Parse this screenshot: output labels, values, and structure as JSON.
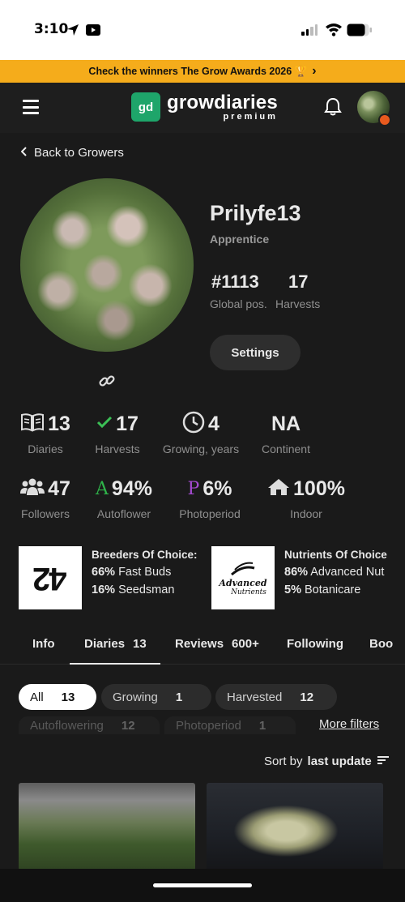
{
  "status_bar": {
    "time": "3:10"
  },
  "banner": {
    "text": "Check the winners The Grow Awards 2026 🏆",
    "arrow": "›"
  },
  "header": {
    "logo_mark": "gd",
    "logo_name": "growdiaries",
    "logo_sub": "premium"
  },
  "back_link": "Back to Growers",
  "profile": {
    "username": "Prilyfe13",
    "rank": "Apprentice",
    "global_pos": "#1113",
    "global_pos_label": "Global pos.",
    "harvests": "17",
    "harvests_label": "Harvests",
    "settings_label": "Settings"
  },
  "stats": [
    {
      "icon": "book-icon",
      "value": "13",
      "label": "Diaries"
    },
    {
      "icon": "harvest-check-icon",
      "value": "17",
      "label": "Harvests"
    },
    {
      "icon": "clock-icon",
      "value": "4",
      "label": "Growing, years"
    },
    {
      "icon": "",
      "value": "NA",
      "label": "Continent"
    },
    {
      "icon": "users-icon",
      "value": "47",
      "label": "Followers"
    },
    {
      "icon": "A",
      "value": "94%",
      "label": "Autoflower"
    },
    {
      "icon": "P",
      "value": "6%",
      "label": "Photoperiod"
    },
    {
      "icon": "home-icon",
      "value": "100%",
      "label": "Indoor"
    }
  ],
  "breeders": {
    "title": "Breeders Of Choice:",
    "logo_text": "42",
    "items": [
      {
        "pct": "66%",
        "name": "Fast Buds"
      },
      {
        "pct": "16%",
        "name": "Seedsman"
      }
    ]
  },
  "nutrients": {
    "title": "Nutrients Of Choice",
    "logo_line1": "Advanced",
    "logo_line2": "Nutrients",
    "items": [
      {
        "pct": "86%",
        "name": "Advanced Nut"
      },
      {
        "pct": "5%",
        "name": "Botanicare"
      }
    ]
  },
  "tabs": [
    {
      "label": "Info",
      "count": ""
    },
    {
      "label": "Diaries",
      "count": "13"
    },
    {
      "label": "Reviews",
      "count": "600+"
    },
    {
      "label": "Following",
      "count": ""
    },
    {
      "label": "Boo",
      "count": ""
    }
  ],
  "filters": [
    {
      "label": "All",
      "count": "13",
      "active": true
    },
    {
      "label": "Growing",
      "count": "1"
    },
    {
      "label": "Harvested",
      "count": "12"
    },
    {
      "label": "Autoflowering",
      "count": "12"
    },
    {
      "label": "Photoperiod",
      "count": "1"
    }
  ],
  "more_filters": "More filters",
  "sort": {
    "prefix": "Sort by",
    "value": "last update"
  }
}
